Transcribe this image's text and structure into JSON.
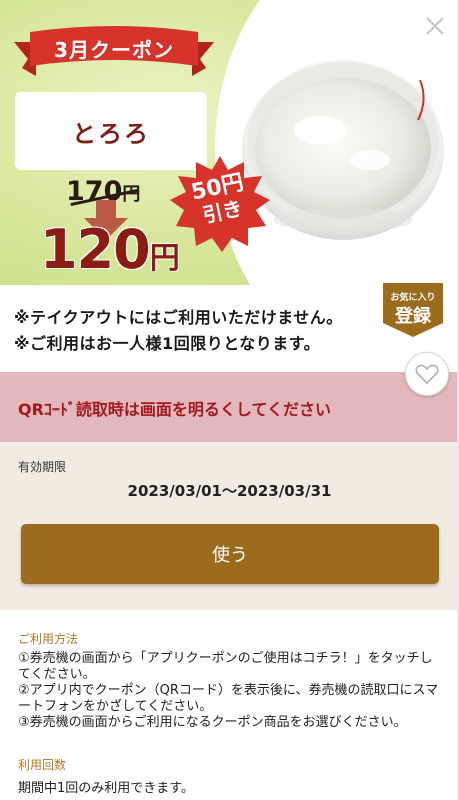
{
  "coupon": {
    "ribbon_title": "3月クーポン",
    "product_name": "とろろ",
    "old_price_number": "170",
    "old_price_unit": "円",
    "new_price_number": "120",
    "new_price_unit": "円",
    "discount_line1": "50円",
    "discount_line2": "引き"
  },
  "notes": {
    "line1": "※テイクアウトにはご利用いただけません。",
    "line2": "※ご利用はお一人様1回限りとなります。"
  },
  "favorite": {
    "small_label": "お気に入り",
    "big_label": "登録"
  },
  "qr_banner": "QRｺｰﾄﾞ読取時は画面を明るくしてください",
  "validity": {
    "label": "有効期限",
    "dates": "2023/03/01〜2023/03/31"
  },
  "use_button": "使う",
  "howto": {
    "label": "ご利用方法",
    "steps": [
      "①券売機の画面から「アプリクーポンのご使用はコチラ！」をタッチしてください。",
      "②アプリ内でクーポン（QRコード）を表示後に、券売機の読取口にスマートフォンをかざしてください。",
      "③券売機の画面からご利用になるクーポン商品をお選びください。"
    ]
  },
  "usage_count": {
    "label": "利用回数",
    "text": "期間中1回のみ利用できます。"
  },
  "colors": {
    "ribbon_red": "#d6332a",
    "price_red": "#8a1c14",
    "banner_pink": "#e2b8bc",
    "banner_text": "#a3171f",
    "button_brown": "#9b6b1e",
    "label_gold": "#b4772a"
  },
  "icons": {
    "close": "close-icon",
    "heart": "heart-icon",
    "arrow": "down-arrow-icon"
  }
}
